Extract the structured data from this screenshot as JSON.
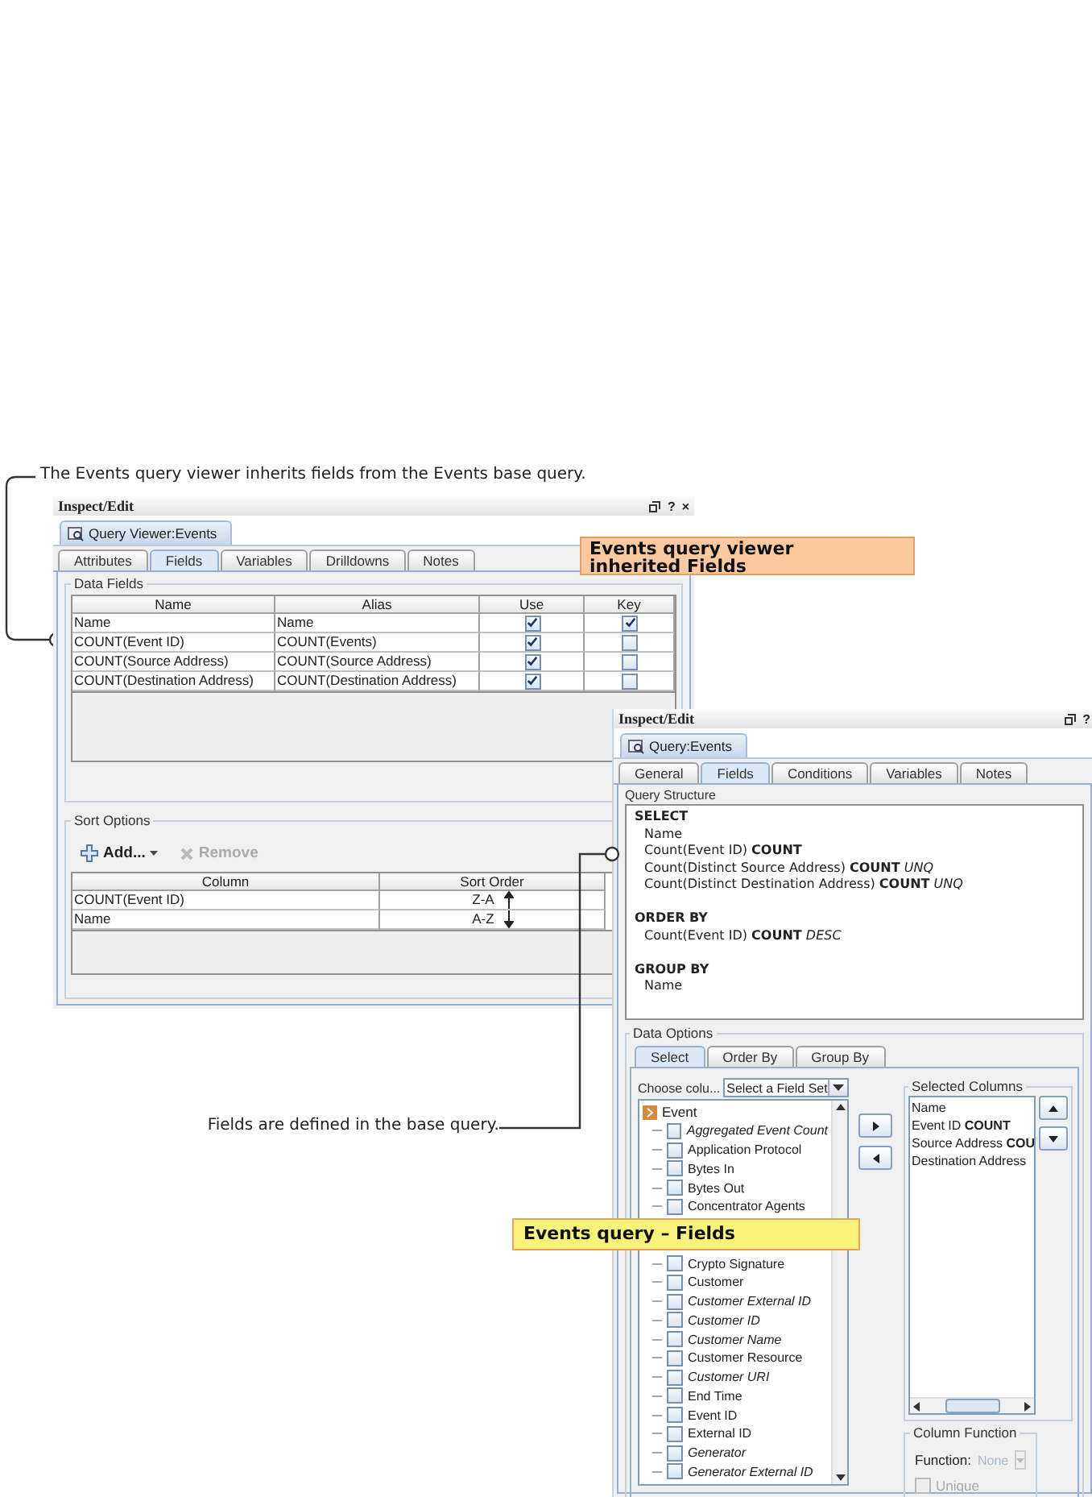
{
  "caption_top": "The Events query viewer inherits fields from the Events base query.",
  "caption_bottom": "Fields are defined in the base query.",
  "callouts": [
    {
      "text": "Events query viewer inherited Fields",
      "color": "#fbc9a0"
    },
    {
      "text": "Events query – Fields",
      "color": "#fbf27a"
    }
  ],
  "viewer_window": {
    "title": "Inspect/Edit",
    "title_buttons": [
      "?",
      "×"
    ],
    "document_tab": "Query Viewer:Events",
    "tabs": [
      {
        "label": "Attributes",
        "selected": false
      },
      {
        "label": "Fields",
        "selected": true
      },
      {
        "label": "Variables",
        "selected": false
      },
      {
        "label": "Drilldowns",
        "selected": false
      },
      {
        "label": "Notes",
        "selected": false
      }
    ],
    "data_fields": {
      "title": "Data Fields",
      "columns": [
        "Name",
        "Alias",
        "Use",
        "Key"
      ],
      "rows": [
        {
          "name": "Name",
          "alias": "Name",
          "use": true,
          "key": true
        },
        {
          "name": "COUNT(Event ID)",
          "alias": "COUNT(Events)",
          "use": true,
          "key": false
        },
        {
          "name": "COUNT(Source Address)",
          "alias": "COUNT(Source Address)",
          "use": true,
          "key": false
        },
        {
          "name": "COUNT(Destination Address)",
          "alias": "COUNT(Destination Address)",
          "use": true,
          "key": false
        }
      ]
    },
    "sort_options": {
      "title": "Sort Options",
      "add_button": "Add...",
      "remove_button": {
        "label": "Remove",
        "disabled": true
      },
      "columns": [
        "Column",
        "Sort Order"
      ],
      "rows": [
        {
          "column": "COUNT(Event ID)",
          "order": "Z-A",
          "kind": "descending"
        },
        {
          "column": "Name",
          "order": "A-Z",
          "kind": "ascending"
        }
      ]
    }
  },
  "query_window": {
    "title": "Inspect/Edit",
    "title_buttons": [
      "?"
    ],
    "document_tab": "Query:Events",
    "tabs": [
      {
        "label": "General",
        "selected": false
      },
      {
        "label": "Fields",
        "selected": true
      },
      {
        "label": "Conditions",
        "selected": false
      },
      {
        "label": "Variables",
        "selected": false
      },
      {
        "label": "Notes",
        "selected": false
      }
    ],
    "query_structure": {
      "title": "Query Structure",
      "lines": [
        {
          "kind": "keyword",
          "text": "SELECT"
        },
        {
          "kind": "item",
          "text": "Name"
        },
        {
          "kind": "item",
          "text": "Count(Event ID) **COUNT**"
        },
        {
          "kind": "item",
          "text": "Count(Distinct Source Address) **COUNT** *UNQ*"
        },
        {
          "kind": "item",
          "text": "Count(Distinct Destination Address) **COUNT** *UNQ*"
        },
        {
          "kind": "keyword",
          "text": "ORDER BY"
        },
        {
          "kind": "item",
          "text": "Count(Event ID) **COUNT** *DESC*"
        },
        {
          "kind": "keyword",
          "text": "GROUP BY"
        },
        {
          "kind": "item",
          "text": "Name"
        }
      ]
    },
    "data_options": {
      "title": "Data Options",
      "tabs": [
        {
          "label": "Select",
          "selected": true
        },
        {
          "label": "Order By",
          "selected": false
        },
        {
          "label": "Group By",
          "selected": false
        }
      ],
      "choose_label": "Choose colu...",
      "field_set": {
        "value": "Select a Field Set"
      },
      "tree": {
        "label": "Event",
        "children": [
          {
            "kind": "field",
            "label": "Aggregated Event Count",
            "italic": true,
            "checked": false
          },
          {
            "kind": "field",
            "label": "Application Protocol",
            "italic": false,
            "checked": false
          },
          {
            "kind": "field",
            "label": "Bytes In",
            "italic": false,
            "checked": false
          },
          {
            "kind": "field",
            "label": "Bytes Out",
            "italic": false,
            "checked": false
          },
          {
            "kind": "field",
            "label": "Concentrator Agents",
            "italic": false,
            "checked": false
          },
          {
            "kind": "covered"
          },
          {
            "kind": "covered"
          },
          {
            "kind": "field",
            "label": "Crypto Signature",
            "italic": false,
            "checked": false
          },
          {
            "kind": "field",
            "label": "Customer",
            "italic": false,
            "checked": false
          },
          {
            "kind": "field",
            "label": "Customer External ID",
            "italic": true,
            "checked": false
          },
          {
            "kind": "field",
            "label": "Customer ID",
            "italic": true,
            "checked": false
          },
          {
            "kind": "field",
            "label": "Customer Name",
            "italic": true,
            "checked": false
          },
          {
            "kind": "field",
            "label": "Customer Resource",
            "italic": false,
            "checked": false
          },
          {
            "kind": "field",
            "label": "Customer URI",
            "italic": true,
            "checked": false
          },
          {
            "kind": "field",
            "label": "End Time",
            "italic": false,
            "checked": false
          },
          {
            "kind": "field",
            "label": "Event ID",
            "italic": false,
            "checked": false
          },
          {
            "kind": "field",
            "label": "External ID",
            "italic": false,
            "checked": false
          },
          {
            "kind": "field",
            "label": "Generator",
            "italic": true,
            "checked": false
          },
          {
            "kind": "field",
            "label": "Generator External ID",
            "italic": true,
            "checked": false
          }
        ]
      },
      "selected_columns": {
        "title": "Selected Columns",
        "items": [
          "Name",
          "Event ID **COUNT**",
          "Source Address **COU**",
          "Destination Address"
        ]
      },
      "column_function": {
        "title": "Column Function",
        "function_label": "Function:",
        "function_value": "None",
        "disabled": true,
        "unique_label": "Unique",
        "unique_checked": false
      }
    }
  }
}
